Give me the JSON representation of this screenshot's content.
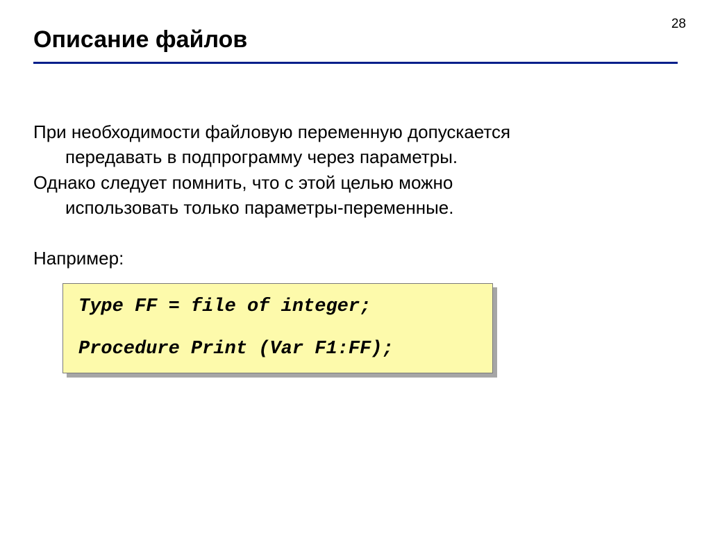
{
  "page_number": "28",
  "title": "Описание файлов",
  "paragraph1_line1": "При необходимости файловую переменную допускается",
  "paragraph1_line2": "передавать в подпрограмму через параметры.",
  "paragraph2_line1": "Однако следует помнить, что с этой целью можно",
  "paragraph2_line2": "использовать только параметры-переменные.",
  "example_label": "Например:",
  "code": {
    "line1": "Type FF = file of integer;",
    "line2": "Procedure Print (Var F1:FF);"
  }
}
